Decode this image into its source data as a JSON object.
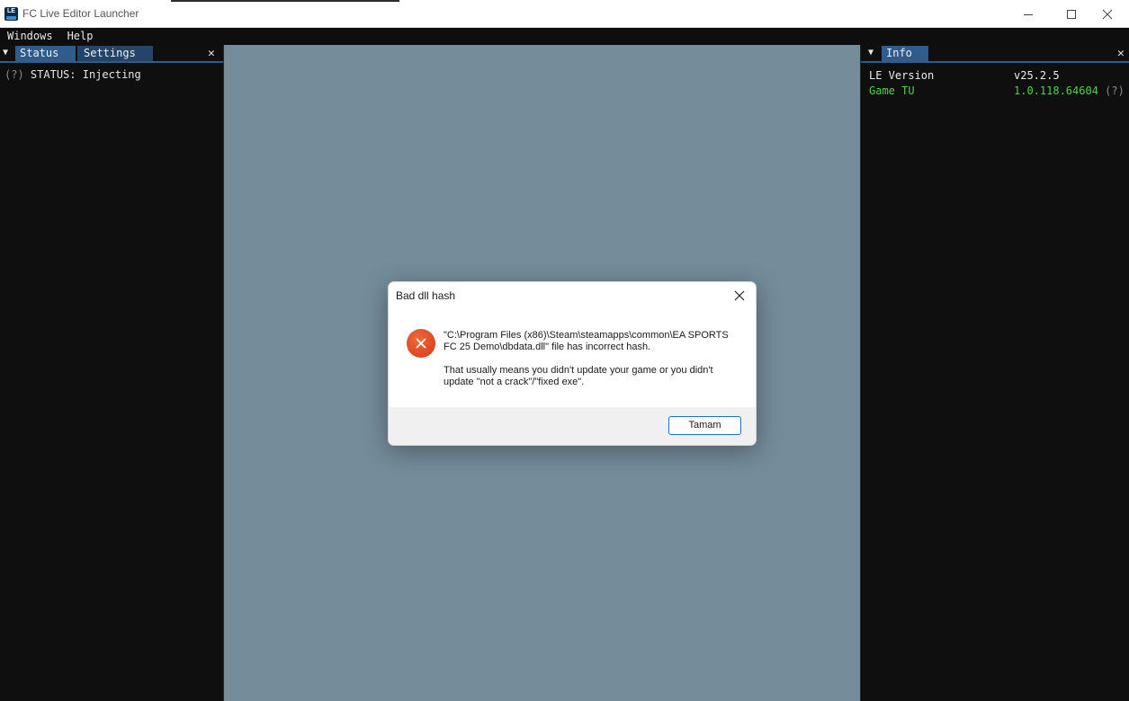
{
  "window": {
    "title": "FC Live Editor Launcher",
    "icon_text": "LE"
  },
  "menu": {
    "items": [
      "Windows",
      "Help"
    ]
  },
  "left_panel": {
    "tabs": [
      {
        "label": "Status",
        "active": true
      },
      {
        "label": "Settings",
        "active": false
      }
    ],
    "close_glyph": "✕",
    "status_help": "(?)",
    "status_text": "STATUS: Injecting"
  },
  "right_panel": {
    "tabs": [
      {
        "label": "Info",
        "active": true
      }
    ],
    "close_glyph": "✕",
    "rows": [
      {
        "key": "LE Version",
        "value": "v25.2.5",
        "color": "#ececec"
      },
      {
        "key": "Game TU",
        "value": "1.0.118.64604",
        "help": "(?)",
        "color": "#4ed34a"
      }
    ]
  },
  "dialog": {
    "title": "Bad dll hash",
    "message_line1": "\"C:\\Program Files (x86)\\Steam\\steamapps\\common\\EA SPORTS FC 25 Demo\\dbdata.dll\" file has incorrect hash.",
    "message_line2": "That usually means you didn't update your game or you didn't update \"not a crack\"/\"fixed exe\".",
    "ok_label": "Tamam",
    "icon": "error-icon"
  },
  "colors": {
    "background": "#758c9a",
    "panel": "#0f0f0f",
    "tab_active": "#2f5c8a",
    "accent_green": "#4ed34a",
    "error_red": "#d3391a"
  }
}
